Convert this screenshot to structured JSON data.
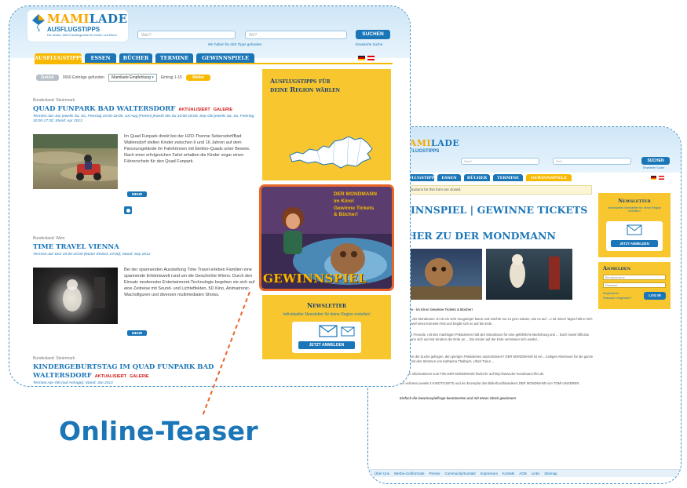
{
  "colors": {
    "brand_blue": "#1b76b8",
    "brand_yellow": "#f7b900",
    "side_yellow": "#f8c730",
    "highlight_orange": "#e8662a",
    "frame_dashed": "#3f8fc7"
  },
  "site": {
    "logo_main_1": "MAMI",
    "logo_main_2": "LADE",
    "logo_sub": "AUSFLUGSTIPPS",
    "logo_tag": "Die besten 16670 Ausflugsziele für Kinder und Eltern",
    "search_what_placeholder": "Was?",
    "search_where_placeholder": "Wo?",
    "search_button": "SUCHEN",
    "search_hint": "Wir haben für dich Tipps gefunden",
    "extended_search": "Erweiterte Suche",
    "nav": [
      "AUSFLUGSTIPPS",
      "ESSEN",
      "BÜCHER",
      "TERMINE",
      "GEWINNSPIELE"
    ]
  },
  "left_page": {
    "pager": {
      "back": "Zurück",
      "count_text": "3666 Einträge gefunden",
      "sort_select": "Mamilade Empfehlung",
      "range": "Eintrag 1-15",
      "next": "Weiter"
    },
    "entries": [
      {
        "region": "Bundesland: Steiermark",
        "title": "QUAD FUNPARK BAD WALTERSDORF",
        "tags": [
          "AKTUALISIERT",
          "GALERIE"
        ],
        "meta": "Termine:Jan-Jun jeweils Sa, So, Feiertag 10:00-18:00, Jul-Aug (Ferien) jeweils Mo-So 10:00-18:00, Sep-Okt jeweils Sa, So, Feiertag 10:00-17:30; Stand: Apr 2013",
        "text": "Im Quad Funpark direkt bei der H2O-Therme Sebersdorf/Bad Waltersdorf stellen Kinder zwischen 6 und 16 Jahren auf dem Parcoursgelände ihr Fahrkönnen mit Elektro-Quads unter Beweis. Nach einer erfolgreichen Fahrt erhalten die Kinder sogar einen Führerschein für den Quad Funpark.",
        "more": "MEHR"
      },
      {
        "region": "Bundesland: Wien",
        "title": "TIME TRAVEL VIENNA",
        "tags": [],
        "meta": "Termine:Jan-Dez 10:00-20:00 (letzter Einlass 19:00); Stand: Sep 2012",
        "text": "Bei der spannenden Ausstellung Time Travel erleben Familien eine spannende Erlebniswelt rund um die Geschichte Wiens. Durch den Einsatz modernster Entertainment-Technologie begeben sie sich auf eine Zeitreise mit Sound- und Lichteffekten, 5D Kino, Animatronic-Wachsfiguren und diversen multimedialen Shows.",
        "more": "MEHR"
      },
      {
        "region": "Bundesland: Steiermark",
        "title": "KINDERGEBURTSTAG IM QUAD FUNPARK BAD WALTERSDORF",
        "tags": [
          "AKTUALISIERT",
          "GALERIE"
        ],
        "meta": "Termine:Apr-Okt (auf Anfrage); Stand: Jan 2013"
      }
    ],
    "side_region_title": "Ausflugstipps für deine Region wählen",
    "teaser": {
      "line1": "DER MONDMANN",
      "line2": "im Kino!",
      "line3": "Gewinne Tickets",
      "line4": "& Bücher!",
      "banner": "GEWINNSPIEL"
    },
    "newsletter": {
      "title": "Newsletter",
      "text": "Individueller Newsletter für deine Region erstellen!",
      "button": "JETZT ANMELDEN"
    }
  },
  "right_page": {
    "notice": "...pplications for this form are closed.",
    "title_line1": "WINNSPIEL | GEWINNE TICKETS &",
    "title_line2": "CHER ZU DER MONDMANN",
    "intro_heading": "...dmann - im Kino! Gewinne Tickets & Bücher!",
    "paragraphs": [
      "...mann, der Mondmann. Er ist ein sehr neugieriger Mann und möchte nur zu gern wissen, wie es auf ...e ist. Eines Tages hält er sich am Schweif eines Kometen fest und begibt sich so auf die Erde.",
      "...nanten Freunde, mit den mächtigen Präsidenten hält den Mondmann für eine gefährliche Bedrohung und ... Doch soviel fällt das Mondmann sich und mit Kindern der Erde an ... Die Kinder auf der Erde vermissen sich wieder...",
      "...mal von der Suche gelingen, den gierigen Präsidenten auszutricksen? DER MONDMANN ist ein ...lustiges Abenteuer für die ganze Familie mit den Stimmen von Katharina Thalbach, Ulrich Tukur ...",
      "Weitere Informationen zum Film DER MONDMANN findet ihr auf http://www.der-mondmann-film.de",
      "Wir verlosen jeweils 3 KINOTICKETS und ein Exemplar des Bilderbuchklassikers DER MONDMANN von TOMI UNGERER."
    ],
    "closing": "Einfach die Gewinnspielfrage beantworten und mit etwas Glück gewinnen!",
    "newsletter_title": "Newsletter",
    "newsletter_text": "Individueller Newsletter für deine Region erstellen!",
    "newsletter_button": "JETZT ANMELDEN",
    "login": {
      "title": "Anmelden",
      "user_placeholder": "Benutzername",
      "pass_placeholder": "Passwort",
      "register": "Registrieren",
      "forgot": "Passwort vergessen?",
      "button": "LOG IN"
    },
    "footer_links": [
      "Über Uns",
      "Werbe-/Jobformate",
      "Presse",
      "Community/Kontakt",
      "Impressum",
      "Kontakt",
      "AGB",
      "Links",
      "Sitemap"
    ]
  },
  "annotation": {
    "caption": "Online-Teaser"
  }
}
